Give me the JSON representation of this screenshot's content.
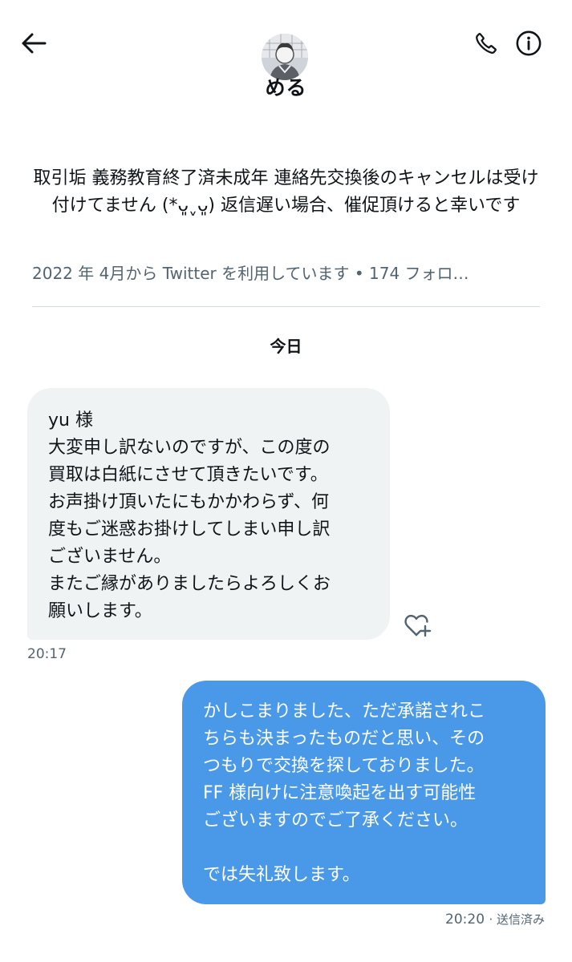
{
  "header": {
    "display_name": "める",
    "icons": {
      "back": "arrow-left-icon",
      "call": "phone-icon",
      "info": "info-icon"
    }
  },
  "profile": {
    "bio": "取引垢 義務教育終了済未成年 連絡先交換後のキャンセルは受け付けてません (*ᴗ͈ˬᴗ͈) 返信遅い場合、催促頂けると幸いです",
    "meta": "2022 年 4月から Twitter を利用しています • 174 フォロ…"
  },
  "date_separator": "今日",
  "messages": {
    "incoming": {
      "lines": [
        "yu 様",
        "大変申し訳ないのですが、この度の",
        "買取は白紙にさせて頂きたいです。",
        "お声掛け頂いたにもかかわらず、何",
        "度もご迷惑お掛けしてしまい申し訳",
        "ございません。",
        "またご縁がありましたらよろしくお",
        "願いします。"
      ],
      "time": "20:17",
      "reaction_icon": "heart-plus-icon"
    },
    "outgoing": {
      "lines": [
        "かしこまりました、ただ承諾されこ",
        "ちらも決まったものだと思い、その",
        "つもりで交換を探しておりました。",
        "FF 様向けに注意喚起を出す可能性",
        "ございますのでご了承ください。",
        "",
        "では失礼致します。"
      ],
      "time": "20:20",
      "status": "· 送信済み"
    }
  },
  "colors": {
    "incoming_bubble": "#eff3f4",
    "outgoing_bubble": "#4a99e9",
    "secondary_text": "#536471"
  }
}
